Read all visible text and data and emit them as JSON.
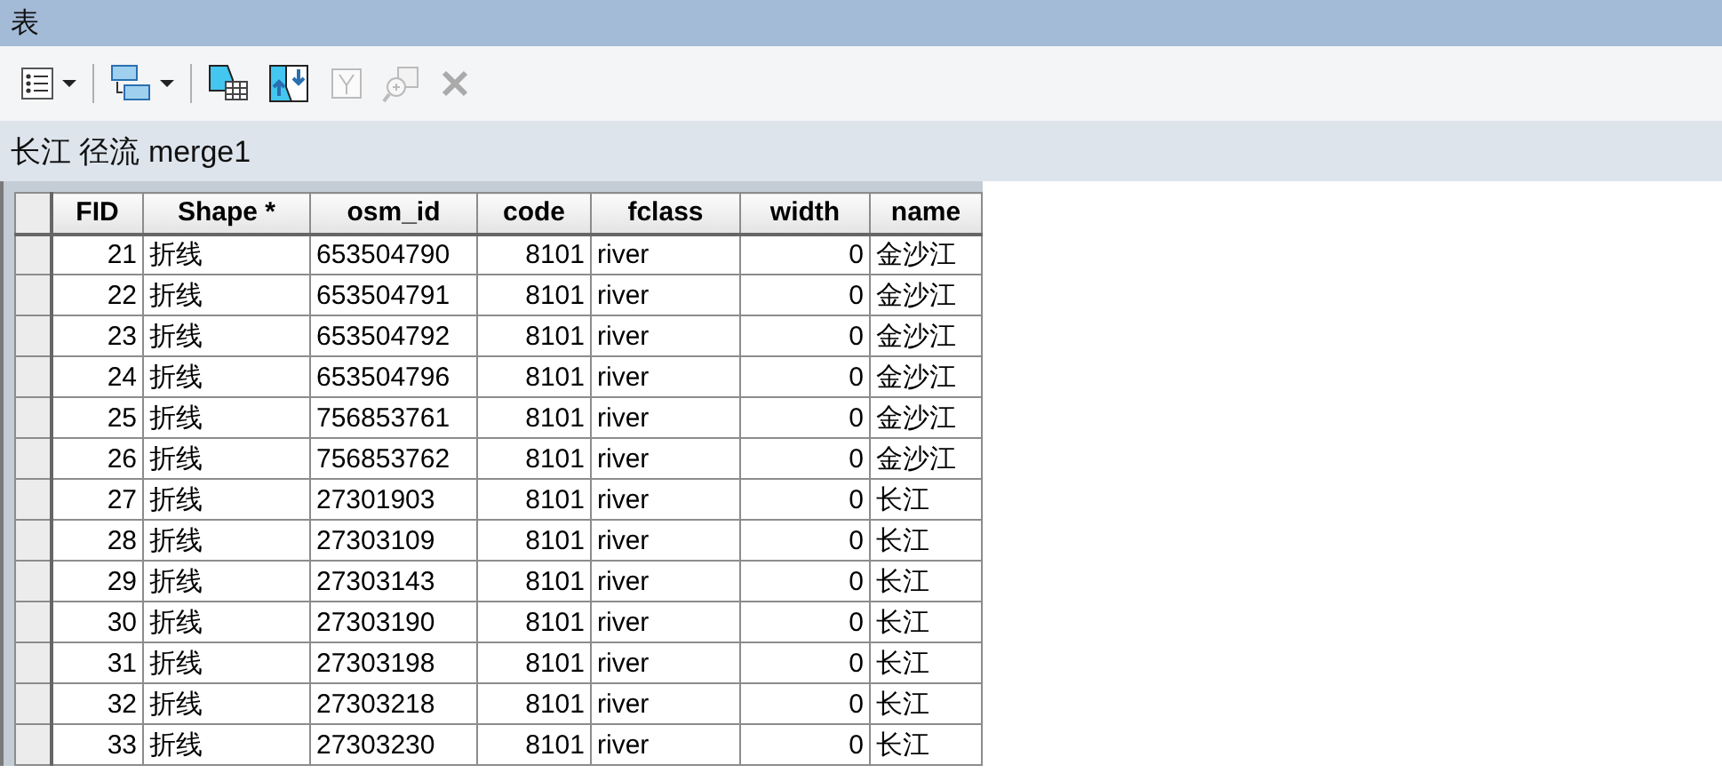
{
  "window": {
    "title": "表"
  },
  "toolbar": [
    {
      "kind": "table-options",
      "dropdown": true,
      "disabled": false
    },
    {
      "kind": "related-tables",
      "dropdown": true,
      "disabled": false
    },
    {
      "kind": "select-by-attributes",
      "dropdown": false,
      "disabled": false
    },
    {
      "kind": "switch-selection",
      "dropdown": false,
      "disabled": false
    },
    {
      "kind": "clear-selection",
      "dropdown": false,
      "disabled": true
    },
    {
      "kind": "zoom-to-selected",
      "dropdown": false,
      "disabled": true
    },
    {
      "kind": "delete-selected",
      "dropdown": false,
      "disabled": true
    }
  ],
  "table_title": "长江 径流 merge1",
  "table": {
    "columns": [
      "FID",
      "Shape *",
      "osm_id",
      "code",
      "fclass",
      "width",
      "name"
    ],
    "rows": [
      [
        "21",
        "折线",
        "653504790",
        "8101",
        "river",
        "0",
        "金沙江"
      ],
      [
        "22",
        "折线",
        "653504791",
        "8101",
        "river",
        "0",
        "金沙江"
      ],
      [
        "23",
        "折线",
        "653504792",
        "8101",
        "river",
        "0",
        "金沙江"
      ],
      [
        "24",
        "折线",
        "653504796",
        "8101",
        "river",
        "0",
        "金沙江"
      ],
      [
        "25",
        "折线",
        "756853761",
        "8101",
        "river",
        "0",
        "金沙江"
      ],
      [
        "26",
        "折线",
        "756853762",
        "8101",
        "river",
        "0",
        "金沙江"
      ],
      [
        "27",
        "折线",
        "27301903",
        "8101",
        "river",
        "0",
        "长江"
      ],
      [
        "28",
        "折线",
        "27303109",
        "8101",
        "river",
        "0",
        "长江"
      ],
      [
        "29",
        "折线",
        "27303143",
        "8101",
        "river",
        "0",
        "长江"
      ],
      [
        "30",
        "折线",
        "27303190",
        "8101",
        "river",
        "0",
        "长江"
      ],
      [
        "31",
        "折线",
        "27303198",
        "8101",
        "river",
        "0",
        "长江"
      ],
      [
        "32",
        "折线",
        "27303218",
        "8101",
        "river",
        "0",
        "长江"
      ],
      [
        "33",
        "折线",
        "27303230",
        "8101",
        "river",
        "0",
        "长江"
      ]
    ]
  }
}
